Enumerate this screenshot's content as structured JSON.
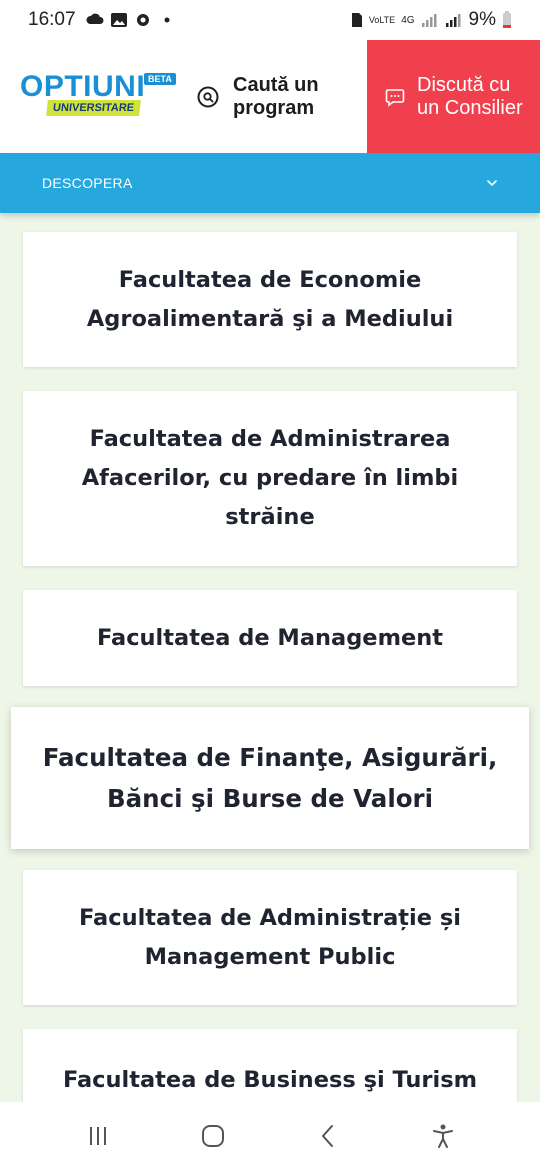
{
  "status_bar": {
    "time": "16:07",
    "network_top": "4G",
    "network_label": "VoLTE",
    "battery": "9%"
  },
  "header": {
    "logo_main": "OPTIUNI",
    "logo_beta": "BETA",
    "logo_sub": "UNIVERSITARE",
    "search_label": "Caută un program",
    "counselor_label": "Discută cu un Consilier"
  },
  "nav": {
    "label": "DESCOPERA"
  },
  "faculties": [
    "Facultatea de Economie Agroalimentară şi a Mediului",
    "Facultatea de Administrarea Afacerilor, cu predare în limbi străine",
    "Facultatea de Management",
    "Facultatea de Finanţe, Asigurări, Bănci şi Burse de Valori",
    "Facultatea de Administrație și Management Public",
    "Facultatea de Business şi Turism"
  ],
  "colors": {
    "accent_blue": "#26a8df",
    "accent_red": "#f0404e",
    "background": "#eef6e8"
  }
}
